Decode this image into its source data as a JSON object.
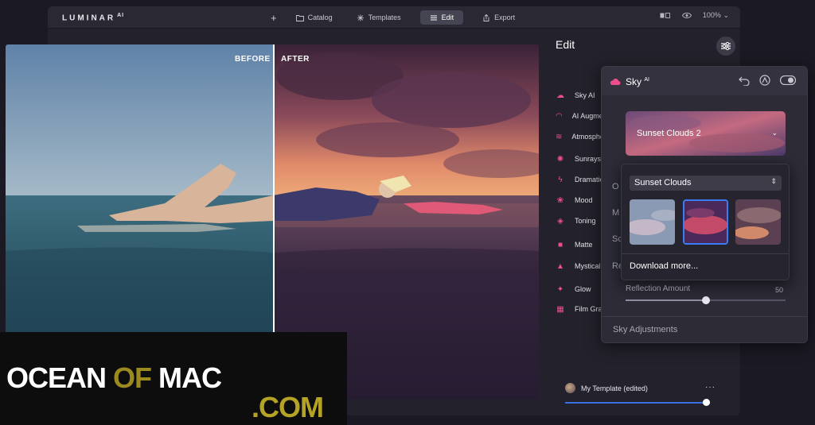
{
  "app": {
    "logo": "LUMINAR",
    "logo_sup": "AI"
  },
  "topbar": {
    "nav": [
      {
        "label": "Catalog",
        "icon": "folder-icon"
      },
      {
        "label": "Templates",
        "icon": "sparkle-icon"
      },
      {
        "label": "Edit",
        "icon": "sliders-icon",
        "active": true
      },
      {
        "label": "Export",
        "icon": "share-icon"
      }
    ],
    "zoom": "100%"
  },
  "photo": {
    "before_label": "BEFORE",
    "after_label": "AFTER"
  },
  "edit_panel": {
    "title": "Edit",
    "tools": [
      {
        "label": "Sky AI",
        "icon": "cloud-icon"
      },
      {
        "label": "AI Augmented Sky",
        "icon": "rainbow-icon"
      },
      {
        "label": "Atmosphere AI",
        "icon": "waves-icon"
      },
      {
        "label": "Sunrays",
        "icon": "sun-icon"
      },
      {
        "label": "Dramatic",
        "icon": "bolt-icon"
      },
      {
        "label": "Mood",
        "icon": "mood-icon"
      },
      {
        "label": "Toning",
        "icon": "paint-bucket-icon"
      },
      {
        "label": "Matte",
        "icon": "square-icon"
      },
      {
        "label": "Mystical",
        "icon": "cone-icon"
      },
      {
        "label": "Glow",
        "icon": "star-icon"
      },
      {
        "label": "Film Grain",
        "icon": "film-icon"
      }
    ],
    "template_name": "My Template (edited)",
    "template_more": "···",
    "template_amount": 1.0
  },
  "sky_panel": {
    "title": "Sky",
    "title_sup": "AI",
    "selected_sky": "Sunset Clouds 2",
    "side_labels": [
      "O",
      "M",
      "Sc",
      "Re"
    ],
    "reflection_label": "Reflection Amount",
    "reflection_value": "50",
    "reflection_amount": 0.5,
    "adjustments_label": "Sky Adjustments"
  },
  "sky_dropdown": {
    "category": "Sunset Clouds",
    "thumbnails": [
      "sky-thumb-pale",
      "sky-thumb-sunset",
      "sky-thumb-dramatic"
    ],
    "selected_index": 1,
    "download_label": "Download more..."
  },
  "watermark": {
    "word1": "OCEAN",
    "word2": "OF",
    "word3": "MAC",
    "suffix": ".COM"
  },
  "colors": {
    "accent_pink": "#ee4f8c",
    "accent_blue": "#3a7df5",
    "watermark_gold": "#b5a325"
  }
}
